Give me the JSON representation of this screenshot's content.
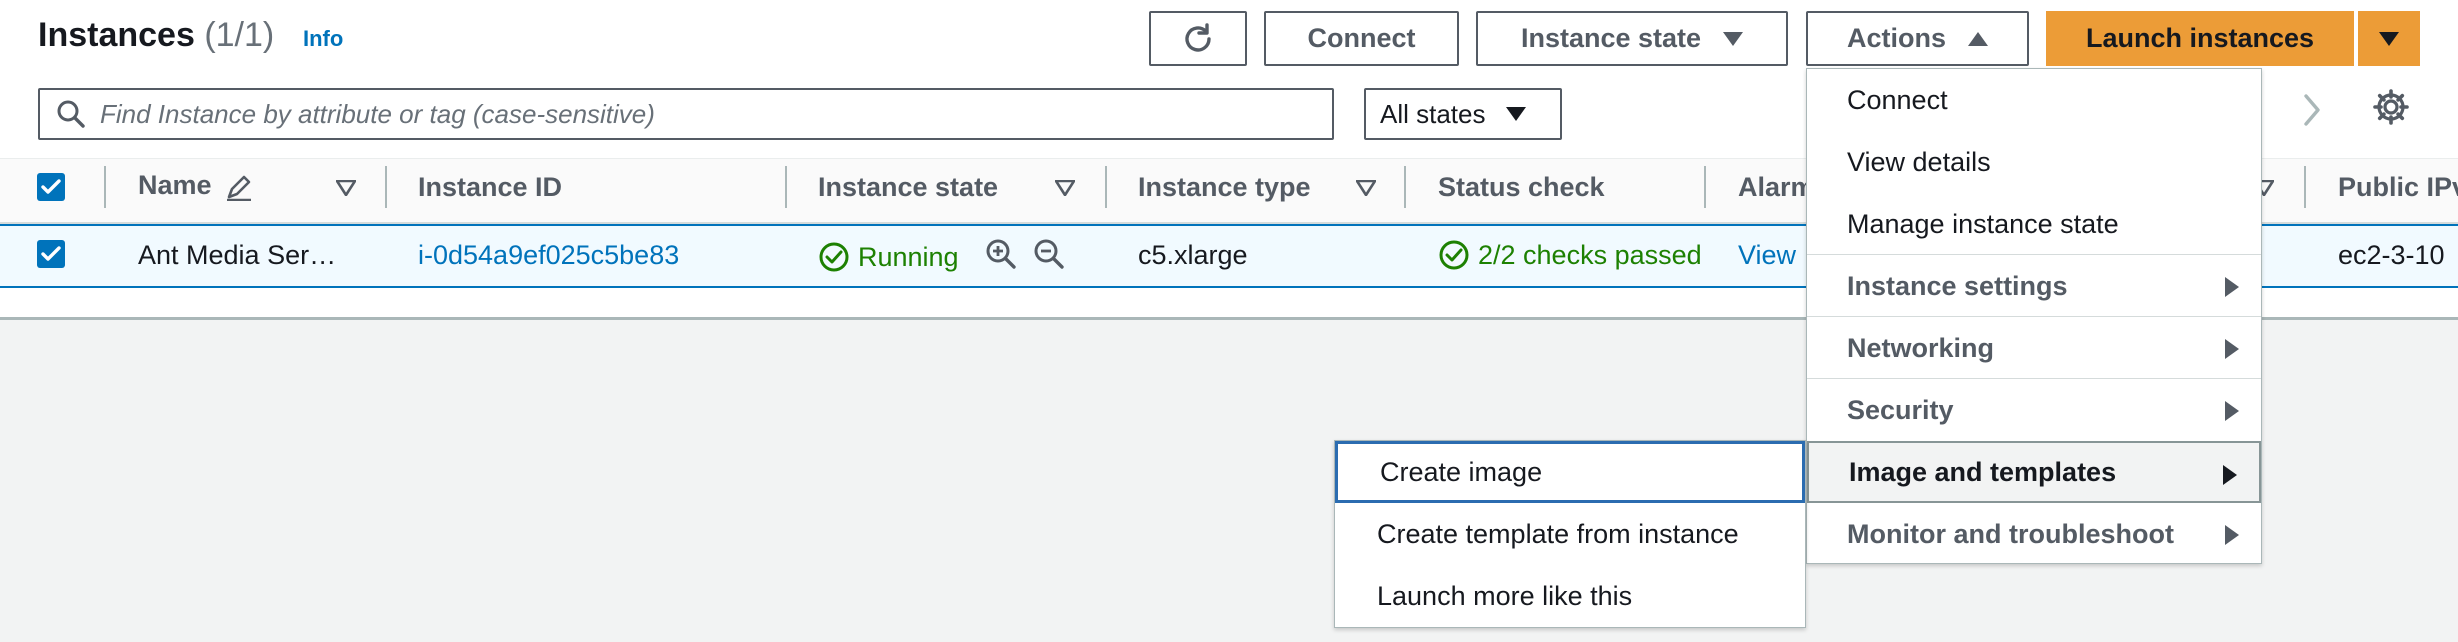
{
  "header": {
    "title": "Instances",
    "count": "(1/1)",
    "info": "Info"
  },
  "toolbar": {
    "connect": "Connect",
    "instance_state": "Instance state",
    "actions": "Actions",
    "launch": "Launch instances"
  },
  "search": {
    "placeholder": "Find Instance by attribute or tag (case-sensitive)",
    "states": "All states"
  },
  "table": {
    "columns": [
      "Name",
      "Instance ID",
      "Instance state",
      "Instance type",
      "Status check",
      "Alarm",
      "Public IPv"
    ],
    "row": {
      "name": "Ant Media Ser…",
      "instance_id": "i-0d54a9ef025c5be83",
      "state": "Running",
      "type": "c5.xlarge",
      "status": "2/2 checks passed",
      "alarm": "View",
      "public_ip": "ec2-3-10"
    }
  },
  "actions_menu": {
    "items": [
      "Connect",
      "View details",
      "Manage instance state"
    ],
    "groups": [
      "Instance settings",
      "Networking",
      "Security",
      "Image and templates",
      "Monitor and troubleshoot"
    ]
  },
  "submenu": {
    "items": [
      "Create image",
      "Create template from instance",
      "Launch more like this"
    ]
  },
  "colors": {
    "link": "#0073bb",
    "success": "#1d8102",
    "primary_button": "#ec9c37"
  }
}
